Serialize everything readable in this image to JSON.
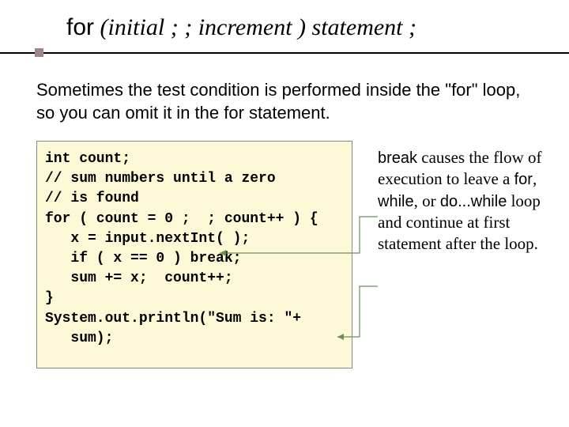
{
  "heading": {
    "kw_for": "for",
    "paren_open": " (",
    "initial": "initial",
    "sep1": " ;  ; ",
    "increment": "increment",
    "paren_close": " ) ",
    "statement": "statement",
    "semicolon": " ;"
  },
  "body_text": "Sometimes the test condition is performed inside the \"for\" loop, so you can omit it in the for statement.",
  "code": "int count;\n// sum numbers until a zero\n// is found\nfor ( count = 0 ;  ; count++ ) {\n   x = input.nextInt( );\n   if ( x == 0 ) break;\n   sum += x;  count++;\n}\nSystem.out.println(\"Sum is: \"+\n   sum);",
  "sidenote": {
    "break_kw": "break",
    "part1": " causes the flow of execution to leave a ",
    "for_kw": "for",
    "part2": ", ",
    "while_kw": "while",
    "part3": ", or ",
    "dowhile_kw": "do...while",
    "part4": " loop and continue at first statement after the loop."
  }
}
